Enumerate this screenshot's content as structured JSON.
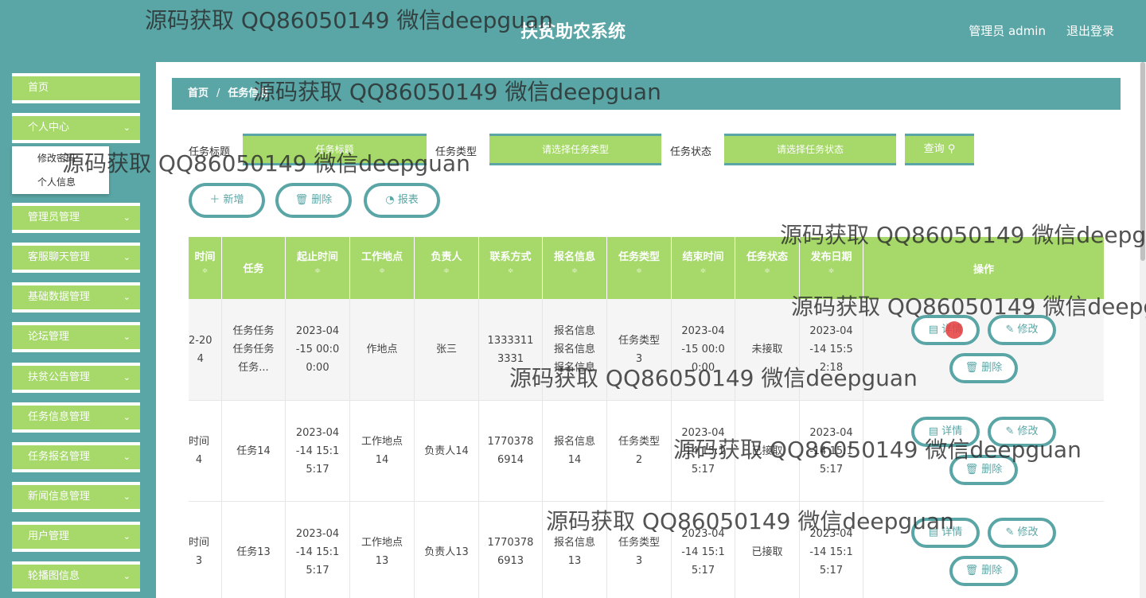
{
  "header": {
    "title": "扶贫助农系统",
    "admin": "管理员 admin",
    "logout": "退出登录"
  },
  "watermark": "源码获取 QQ86050149 微信deepguan",
  "sidebar": {
    "items": [
      {
        "label": "首页",
        "chevron": ""
      },
      {
        "label": "个人中心",
        "chevron": "⌄"
      },
      {
        "label": "管理员管理",
        "chevron": "⌄"
      },
      {
        "label": "客服聊天管理",
        "chevron": "⌄"
      },
      {
        "label": "基础数据管理",
        "chevron": "⌄"
      },
      {
        "label": "论坛管理",
        "chevron": "⌄"
      },
      {
        "label": "扶贫公告管理",
        "chevron": "⌄"
      },
      {
        "label": "任务信息管理",
        "chevron": "⌄"
      },
      {
        "label": "任务报名管理",
        "chevron": "⌄"
      },
      {
        "label": "新闻信息管理",
        "chevron": "⌄"
      },
      {
        "label": "用户管理",
        "chevron": "⌄"
      },
      {
        "label": "轮播图信息",
        "chevron": "⌄"
      }
    ],
    "submenu": [
      "修改密码",
      "个人信息"
    ]
  },
  "breadcrumb": {
    "home": "首页",
    "sep": "/",
    "current": "任务信息"
  },
  "filters": {
    "title_label": "任务标题",
    "title_placeholder": "任务标题",
    "type_label": "任务类型",
    "type_placeholder": "请选择任务类型",
    "status_label": "任务状态",
    "status_placeholder": "请选择任务状态",
    "query": "查询 ⚲"
  },
  "actions": {
    "add": "＋ 新增",
    "delete": "🗑 删除",
    "report": "◔ 报表"
  },
  "table": {
    "columns": [
      "时间",
      "任务",
      "起止时间",
      "工作地点",
      "负责人",
      "联系方式",
      "报名信息",
      "任务类型",
      "结束时间",
      "任务状态",
      "发布日期",
      "操作"
    ],
    "sort_glyph": "≑",
    "rows": [
      {
        "time": "2-20\n4",
        "task": "任务任务\n任务任务\n任务...",
        "start": "2023-04\n-15 00:0\n0:00",
        "place": "作地点",
        "owner": "张三",
        "phone": "1333311\n3331",
        "info": "报名信息\n报名信息\n报名信息",
        "type": "任务类型\n3",
        "end": "2023-04\n-15 00:0\n0:00",
        "status": "未接取",
        "pub": "2023-04\n-14 15:5\n2:18"
      },
      {
        "time": "时间\n4",
        "task": "任务14",
        "start": "2023-04\n-14 15:1\n5:17",
        "place": "工作地点\n14",
        "owner": "负责人14",
        "phone": "1770378\n6914",
        "info": "报名信息\n14",
        "type": "任务类型\n2",
        "end": "2023-04\n-14 15:1\n5:17",
        "status": "已接取",
        "pub": "2023-04\n-14 15:1\n5:17"
      },
      {
        "time": "时间\n3",
        "task": "任务13",
        "start": "2023-04\n-14 15:1\n5:17",
        "place": "工作地点\n13",
        "owner": "负责人13",
        "phone": "1770378\n6913",
        "info": "报名信息\n13",
        "type": "任务类型\n3",
        "end": "2023-04\n-14 15:1\n5:17",
        "status": "已接取",
        "pub": "2023-04\n-14 15:1\n5:17"
      }
    ],
    "btn_detail": "▤ 详情",
    "btn_edit": "✎ 修改",
    "btn_delete": "🗑 删除"
  },
  "colors": {
    "teal": "#5aa5a5",
    "green": "#a6d96a"
  }
}
